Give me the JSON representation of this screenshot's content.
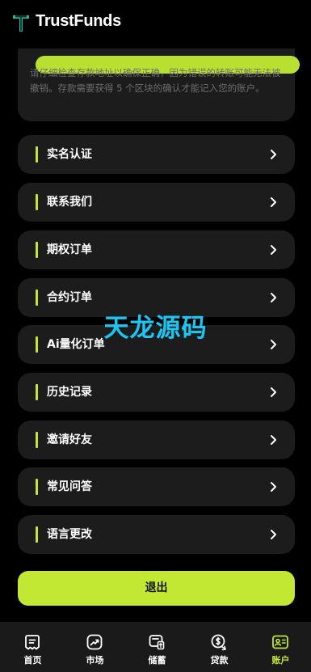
{
  "app": {
    "brand": "TrustFunds"
  },
  "notice": {
    "text": "请仔细检查存款地址以确保正确，因为错误的转账可能无法被撤销。存款需要获得 5 个区块的确认才能记入您的账户。"
  },
  "menu": {
    "items": [
      {
        "id": "verification",
        "label": "实名认证"
      },
      {
        "id": "contact",
        "label": "联系我们"
      },
      {
        "id": "options-orders",
        "label": "期权订单"
      },
      {
        "id": "contract-orders",
        "label": "合约订单"
      },
      {
        "id": "ai-quant-orders",
        "label": "Ai量化订单"
      },
      {
        "id": "history",
        "label": "历史记录"
      },
      {
        "id": "invite-friends",
        "label": "邀请好友"
      },
      {
        "id": "faq",
        "label": "常见问答"
      },
      {
        "id": "language",
        "label": "语言更改"
      }
    ]
  },
  "logout_label": "退出",
  "watermark": "天龙源码",
  "tabbar": {
    "active": "account",
    "tabs": [
      {
        "id": "home",
        "label": "首页",
        "icon": "home-doc-icon"
      },
      {
        "id": "market",
        "label": "市场",
        "icon": "market-trend-icon"
      },
      {
        "id": "savings",
        "label": "储蓄",
        "icon": "savings-icon"
      },
      {
        "id": "loan",
        "label": "贷款",
        "icon": "loan-icon"
      },
      {
        "id": "account",
        "label": "账户",
        "icon": "account-card-icon"
      }
    ]
  },
  "colors": {
    "accent": "#c2e833",
    "card": "#1c1c1c",
    "background": "#000000",
    "tabbar": "#1a1a1a",
    "watermark": "#1cc6f2"
  }
}
